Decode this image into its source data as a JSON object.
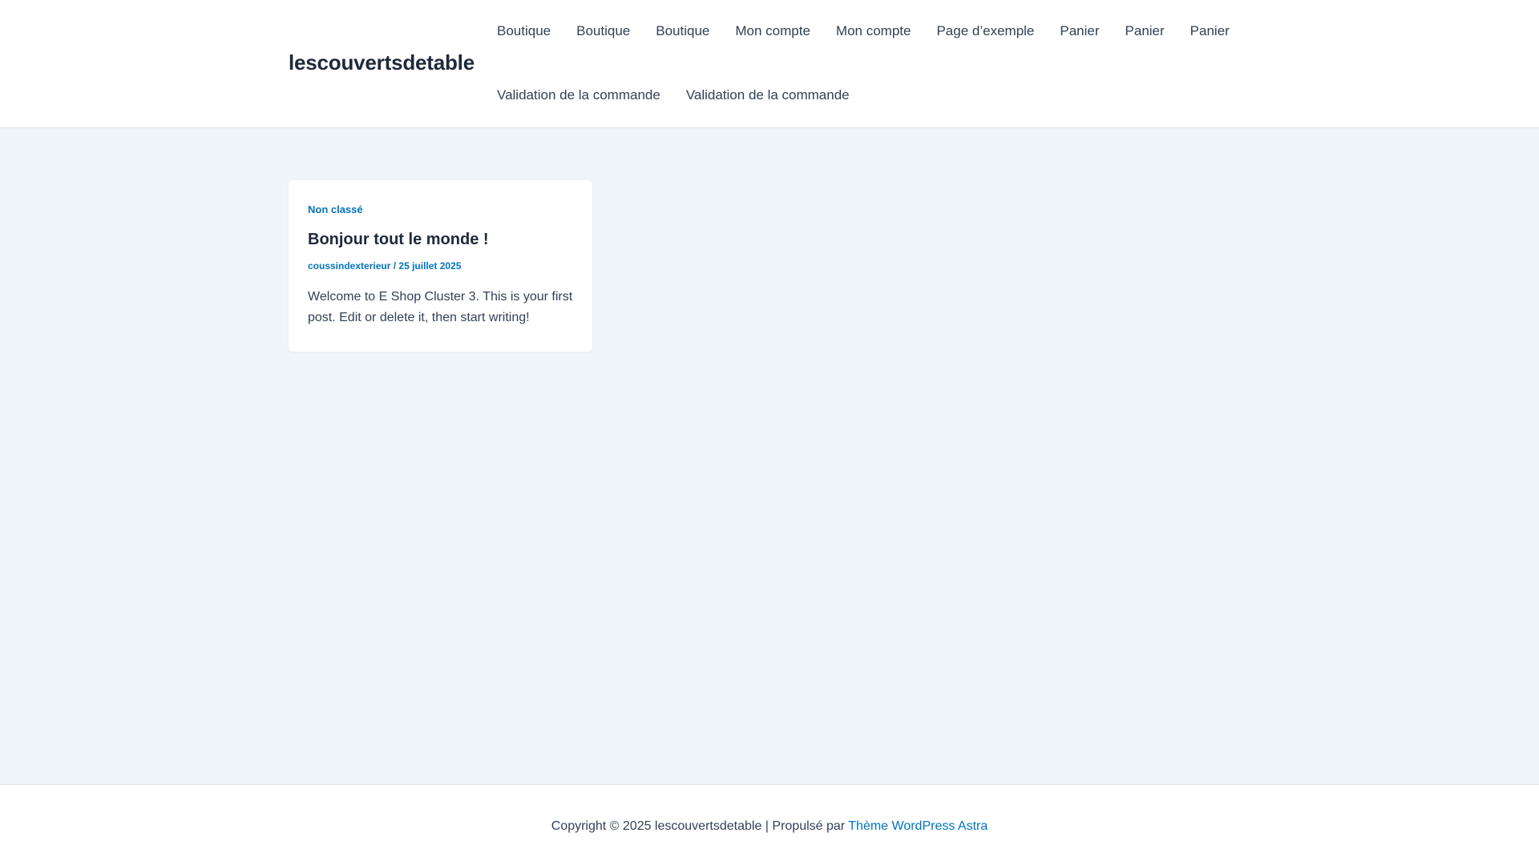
{
  "header": {
    "site_title": "lescouvertsdetable",
    "nav_row1": [
      "Boutique",
      "Boutique",
      "Boutique",
      "Mon compte",
      "Mon compte",
      "Page d’exemple",
      "Panier",
      "Panier",
      "Panier"
    ],
    "nav_row2": [
      "Validation de la commande",
      "Validation de la commande"
    ]
  },
  "post": {
    "category": "Non classé",
    "title": "Bonjour tout le monde !",
    "author": "coussindexterieur",
    "separator": " / ",
    "date": "25 juillet 2025",
    "excerpt": "Welcome to E Shop Cluster 3. This is your first post. Edit or delete it, then start writing!"
  },
  "footer": {
    "copyright": "Copyright © 2025 lescouvertsdetable | Propulsé par ",
    "theme_link": "Thème WordPress Astra"
  },
  "colors": {
    "accent": "#0274be",
    "heading": "#1e293b",
    "text": "#334155",
    "background": "#f0f5fa"
  }
}
